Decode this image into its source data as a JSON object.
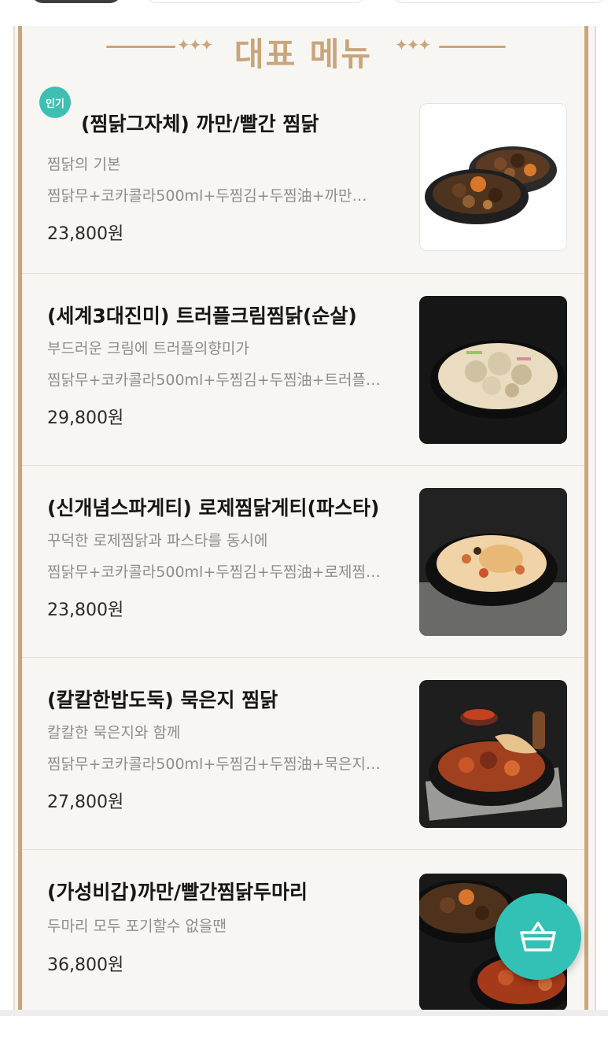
{
  "section": {
    "title": "대표 메뉴"
  },
  "items": [
    {
      "badge": "인기",
      "title": "(찜닭그자체) 까만/빨간 찜닭",
      "desc": "찜닭의 기본",
      "composition": "찜닭무+코카콜라500ml+두찜김+두찜油+까만…",
      "price": "23,800원"
    },
    {
      "title": "(세계3대진미) 트러플크림찜닭(순살)",
      "desc": "부드러운 크림에 트러플의향미가",
      "composition": "찜닭무+코카콜라500ml+두찜김+두찜油+트러플…",
      "price": "29,800원"
    },
    {
      "title": "(신개념스파게티) 로제찜닭게티(파스타)",
      "desc": "꾸덕한 로제찜닭과 파스타를 동시에",
      "composition": "찜닭무+코카콜라500ml+두찜김+두찜油+로제찜…",
      "price": "23,800원"
    },
    {
      "title": "(칼칼한밥도둑) 묵은지 찜닭",
      "desc": "칼칼한 묵은지와 함께",
      "composition": "찜닭무+코카콜라500ml+두찜김+두찜油+묵은지…",
      "price": "27,800원"
    },
    {
      "title": "(가성비갑)까만/빨간찜닭두마리",
      "desc": "두마리 모두 포기할수 없을땐",
      "price": "36,800원"
    }
  ],
  "cart": {
    "icon": "shopping-basket-icon"
  },
  "colors": {
    "accent": "#c9a57a",
    "badge": "#3fbfb3",
    "fab": "#33c1b6"
  }
}
